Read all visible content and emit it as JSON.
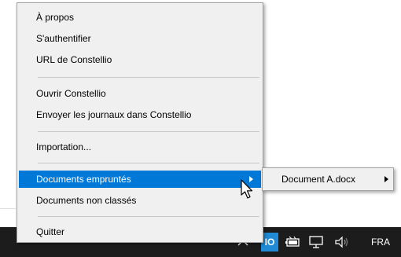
{
  "menu": {
    "items": [
      {
        "label": "À propos"
      },
      {
        "label": "S'authentifier"
      },
      {
        "label": "URL de Constellio"
      },
      {
        "label": "Ouvrir Constellio"
      },
      {
        "label": "Envoyer les journaux dans Constellio"
      },
      {
        "label": "Importation..."
      },
      {
        "label": "Documents empruntés",
        "highlighted": true,
        "has_submenu": true
      },
      {
        "label": "Documents non classés"
      },
      {
        "label": "Quitter"
      }
    ]
  },
  "submenu": {
    "items": [
      {
        "label": "Document A.docx",
        "has_submenu": true
      }
    ]
  },
  "taskbar": {
    "app_icon_text": "IO",
    "language": "FRA"
  },
  "colors": {
    "highlight": "#0078d7",
    "menu_bg": "#f0f0f0",
    "taskbar_bg": "#1c1c1c"
  },
  "icons": [
    "chevron-up-icon",
    "battery-icon",
    "network-icon",
    "volume-icon",
    "mouse-cursor-icon",
    "submenu-arrow-icon"
  ]
}
